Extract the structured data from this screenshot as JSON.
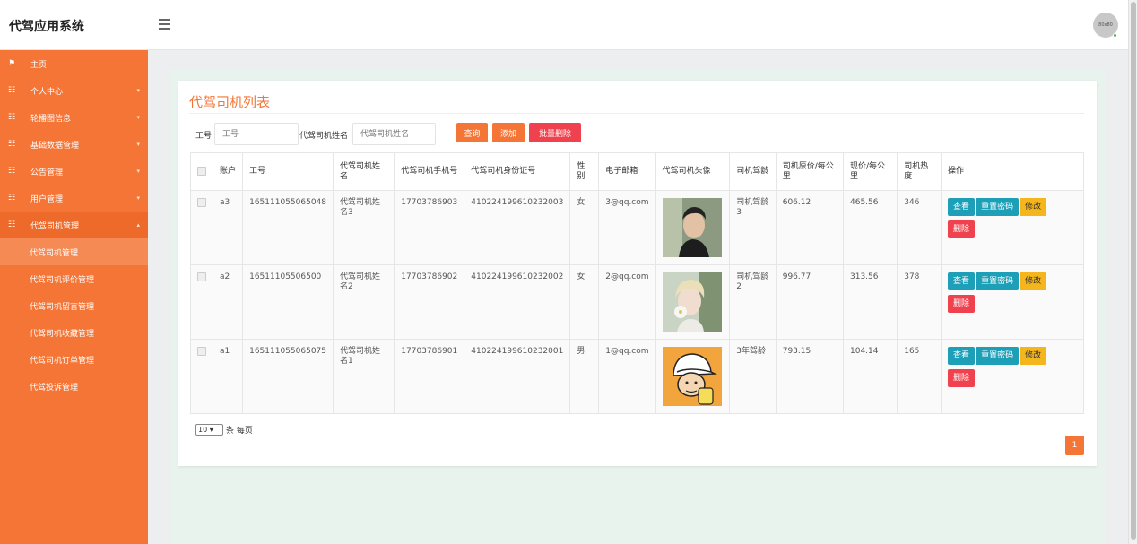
{
  "app": {
    "title": "代驾应用系统",
    "avatar_text": "80x80"
  },
  "sidebar": {
    "items": [
      {
        "label": "主页",
        "icon": "flag-icon",
        "has_caret": false
      },
      {
        "label": "个人中心",
        "icon": "grid-icon",
        "has_caret": true
      },
      {
        "label": "轮播图信息",
        "icon": "grid-icon",
        "has_caret": true
      },
      {
        "label": "基础数据管理",
        "icon": "grid-icon",
        "has_caret": true
      },
      {
        "label": "公告管理",
        "icon": "grid-icon",
        "has_caret": true
      },
      {
        "label": "用户管理",
        "icon": "grid-icon",
        "has_caret": true
      },
      {
        "label": "代驾司机管理",
        "icon": "grid-icon",
        "has_caret": true,
        "open": true
      }
    ],
    "sub_items": [
      {
        "label": "代驾司机管理",
        "active": true
      },
      {
        "label": "代驾司机评价管理"
      },
      {
        "label": "代驾司机留言管理"
      },
      {
        "label": "代驾司机收藏管理"
      },
      {
        "label": "代驾司机订单管理"
      },
      {
        "label": "代驾投诉管理"
      }
    ]
  },
  "page": {
    "title": "代驾司机列表",
    "search": {
      "field1_label": "工号",
      "field1_placeholder": "工号",
      "field2_label": "代驾司机姓名",
      "field2_placeholder": "代驾司机姓名"
    },
    "buttons": {
      "query": "查询",
      "add": "添加",
      "batch_delete": "批量删除"
    }
  },
  "table": {
    "columns": [
      "账户",
      "工号",
      "代驾司机姓名",
      "代驾司机手机号",
      "代驾司机身份证号",
      "性别",
      "电子邮箱",
      "代驾司机头像",
      "司机驾龄",
      "司机原价/每公里",
      "现价/每公里",
      "司机热度",
      "操作"
    ],
    "rows": [
      {
        "account": "a3",
        "job_no": "165111055065048",
        "name": "代驾司机姓名3",
        "phone": "17703786903",
        "id_card": "410224199610232003",
        "gender": "女",
        "email": "3@qq.com",
        "avatar": "photo-man",
        "exp": "司机驾龄3",
        "orig_price": "606.12",
        "price": "465.56",
        "heat": "346"
      },
      {
        "account": "a2",
        "job_no": "16511105506500",
        "name": "代驾司机姓名2",
        "phone": "17703786902",
        "id_card": "410224199610232002",
        "gender": "女",
        "email": "2@qq.com",
        "avatar": "photo-flower",
        "exp": "司机驾龄2",
        "orig_price": "996.77",
        "price": "313.56",
        "heat": "378"
      },
      {
        "account": "a1",
        "job_no": "165111055065075",
        "name": "代驾司机姓名1",
        "phone": "17703786901",
        "id_card": "410224199610232001",
        "gender": "男",
        "email": "1@qq.com",
        "avatar": "photo-cartoon",
        "exp": "3年驾龄",
        "orig_price": "793.15",
        "price": "104.14",
        "heat": "165"
      }
    ],
    "actions": {
      "view": "查看",
      "reset": "重置密码",
      "edit": "修改",
      "delete": "删除"
    }
  },
  "pagination": {
    "page_size": "10",
    "page_size_suffix": "条 每页",
    "current_page": "1"
  },
  "colors": {
    "brand": "#f47536",
    "danger": "#f0424e",
    "info": "#1d9fb8",
    "warning": "#f5b51c"
  }
}
